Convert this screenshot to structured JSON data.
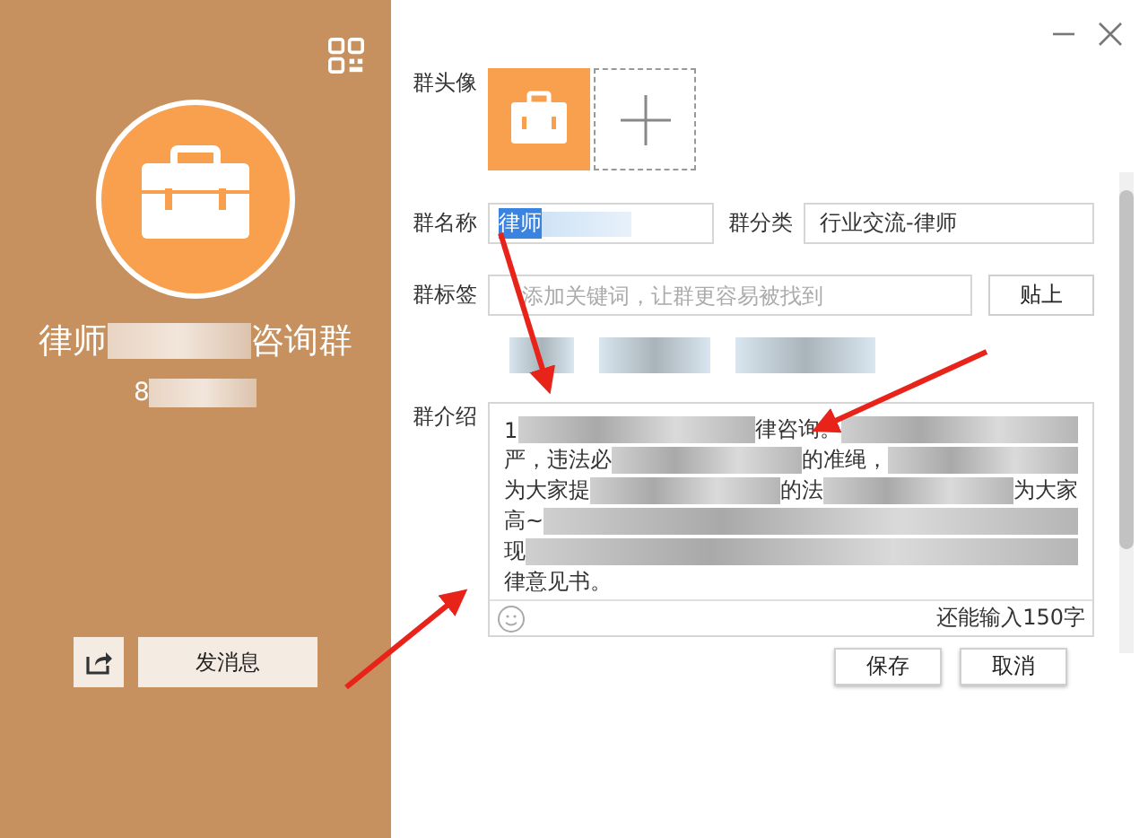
{
  "profile": {
    "name_start": "律师",
    "name_end": "咨询群",
    "number_start": "8",
    "send_button": "发消息"
  },
  "form": {
    "avatar_label": "群头像",
    "name_label": "群名称",
    "name_value": "律师",
    "category_label": "群分类",
    "category_value": "行业交流-律师",
    "tags_label": "群标签",
    "tags_placeholder": "添加关键词，让群更容易被找到",
    "paste_button": "贴上",
    "tags": [
      {
        "kind": "blur"
      },
      {
        "kind": "blur"
      },
      {
        "kind": "blur"
      }
    ],
    "intro_label": "群介绍",
    "intro_lines": [
      [
        {
          "kind": "text",
          "text": "1"
        },
        {
          "kind": "blur"
        },
        {
          "kind": "text",
          "text": "律咨询。"
        },
        {
          "kind": "blur"
        }
      ],
      [
        {
          "kind": "text",
          "text": "严，违法必"
        },
        {
          "kind": "blur"
        },
        {
          "kind": "text",
          "text": "的准绳，"
        },
        {
          "kind": "blur"
        }
      ],
      [
        {
          "kind": "text",
          "text": "为大家提"
        },
        {
          "kind": "blur"
        },
        {
          "kind": "text",
          "text": "的法"
        },
        {
          "kind": "blur"
        },
        {
          "kind": "text",
          "text": "为大家"
        }
      ],
      [
        {
          "kind": "text",
          "text": "高~"
        },
        {
          "kind": "blur"
        }
      ],
      [
        {
          "kind": "text",
          "text": "现"
        },
        {
          "kind": "blur"
        }
      ],
      [
        {
          "kind": "text",
          "text": "律意见书。"
        }
      ]
    ],
    "counter": "还能输入150字",
    "save_button": "保存",
    "cancel_button": "取消"
  }
}
